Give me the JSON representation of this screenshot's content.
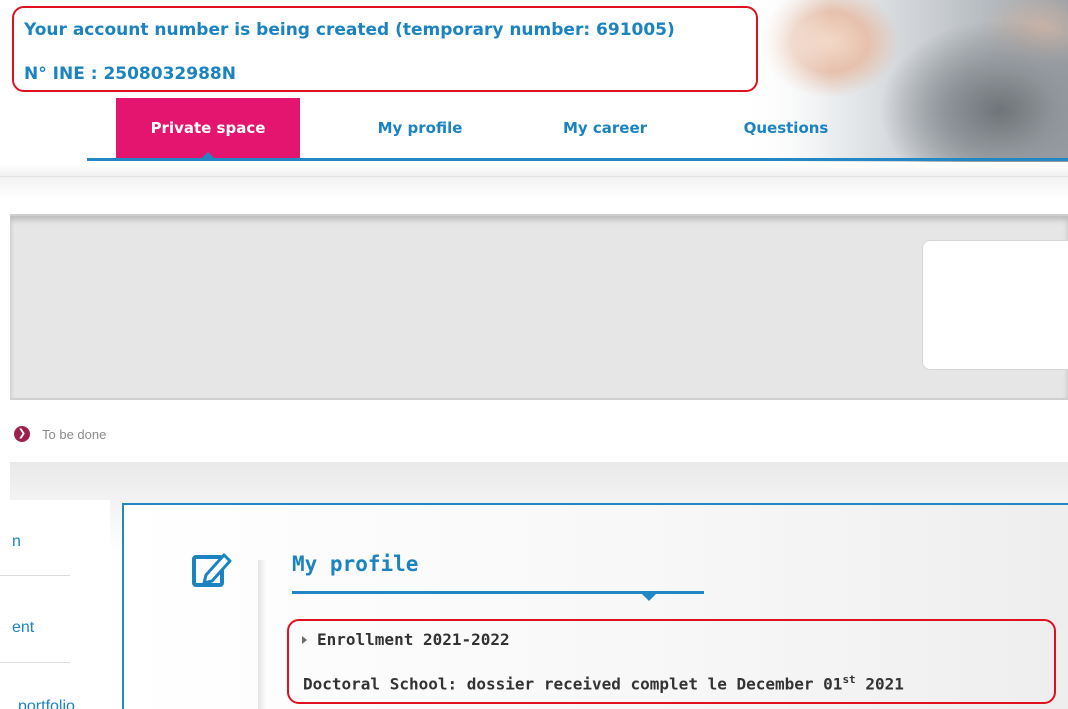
{
  "header": {
    "account_status": "Your account number is being created (temporary number: 691005)",
    "ine": "N° INE : 2508032988N"
  },
  "nav": {
    "tabs": [
      {
        "label": "Private space",
        "active": true
      },
      {
        "label": "My profile",
        "active": false
      },
      {
        "label": "My career",
        "active": false
      },
      {
        "label": "Questions",
        "active": false
      }
    ]
  },
  "status": {
    "todo_label": "To be done"
  },
  "sidebar": {
    "items": [
      {
        "label": "n"
      },
      {
        "label": "ent"
      },
      {
        "label": "portfolio"
      }
    ]
  },
  "profile": {
    "title": "My profile",
    "enrollment_title": "Enrollment 2021-2022",
    "detail_prefix": "Doctoral School: dossier received complet le December 01",
    "detail_sup": "st",
    "detail_suffix": " 2021"
  },
  "colors": {
    "accent_blue": "#1b83bf",
    "active_tab": "#e3156f",
    "highlight_red": "#e0101e"
  },
  "icons": {
    "todo": "chevron-right-circle-icon",
    "edit": "edit-icon",
    "enroll_arrow": "caret-right-icon"
  }
}
